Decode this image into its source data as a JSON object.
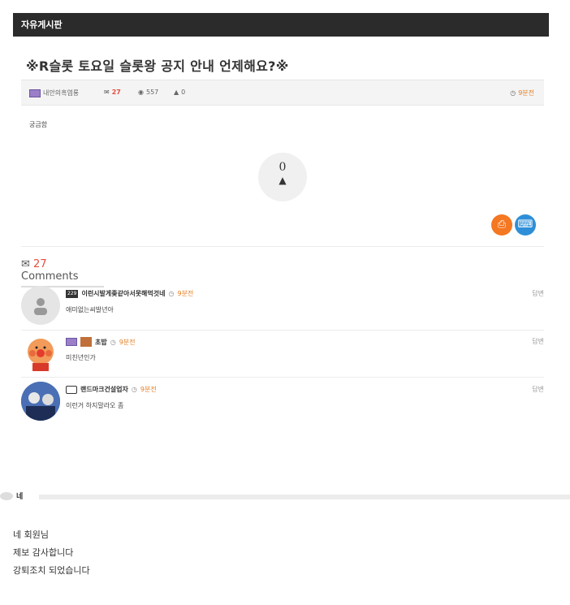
{
  "board": {
    "title": "자유게시판"
  },
  "post": {
    "title": "※R슬롯 토요일 슬롯왕 공지 안내 언제해요?※",
    "author": "내안의흑염룡",
    "comments": "27",
    "views": "557",
    "likes_small": "0",
    "time": "9분전",
    "body": "궁금함",
    "like_count": "0"
  },
  "comments_section": {
    "count": "27",
    "label": "Comments"
  },
  "comments": [
    {
      "nick": "이런시발게좆같아서못해먹것네",
      "level": "229",
      "time": "9분전",
      "text": "애미없는씨발년아",
      "reply": "답변"
    },
    {
      "nick": "초밥",
      "time": "9분전",
      "text": "미친년인가",
      "reply": "답변"
    },
    {
      "nick": "랜드마크건설업자",
      "time": "9분전",
      "text": "이런거 하지말라오 좀",
      "reply": "답변"
    }
  ],
  "admin_reply": {
    "label": "네",
    "lines": [
      "네 회원님",
      "제보 감사합니다",
      "강퇴조치 되었습니다"
    ]
  },
  "icons": {
    "comment": "comment-icon",
    "eye": "eye-icon",
    "thumb": "thumbs-up-icon",
    "clock": "clock-icon",
    "print": "print-icon",
    "attach": "paperclip-icon"
  },
  "colors": {
    "header_bg": "#2b2b2b",
    "accent_red": "#e74c3c",
    "accent_orange": "#f47721",
    "accent_blue": "#2e8fd8"
  }
}
